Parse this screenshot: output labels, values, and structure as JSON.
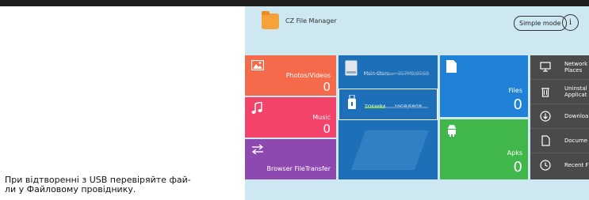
{
  "caption": {
    "line1": "При відтворенні з USB перевіряйте фай-",
    "line2": "ли у Файловому провіднику."
  },
  "header": {
    "app_title": "CZ File Manager",
    "simple_mode_label": "Simple mode",
    "info_label": "i"
  },
  "tiles": {
    "photos": {
      "label": "Photos/Videos",
      "count": "0",
      "icon": "image-icon",
      "color": "#f56a4a"
    },
    "music": {
      "label": "Music",
      "count": "0",
      "icon": "music-note-icon",
      "color": "#f4436b"
    },
    "browser": {
      "label": "Browser FileTransfer",
      "icon": "transfer-arrows-icon",
      "color": "#8e49b0"
    },
    "files": {
      "label": "Files",
      "count": "0",
      "icon": "document-icon",
      "color": "#1f82d6"
    },
    "apks": {
      "label": "Apks",
      "count": "0",
      "icon": "android-icon",
      "color": "#41b64a"
    }
  },
  "storage": {
    "main": {
      "name": "Main Stora...",
      "size": "357MB/25GB",
      "used_fraction": 0.014
    },
    "usb": {
      "name": "TOSHIBA...",
      "size": "19GB/58GB",
      "used_fraction": 0.33
    }
  },
  "side_menu": [
    {
      "label": "Network\nPlaces",
      "icon": "monitor-icon"
    },
    {
      "label": "Uninstal\nApplicat",
      "icon": "trash-icon"
    },
    {
      "label": "Downloa",
      "icon": "download-icon"
    },
    {
      "label": "Docume",
      "icon": "file-icon"
    },
    {
      "label": "Recent F",
      "icon": "clock-icon"
    }
  ]
}
